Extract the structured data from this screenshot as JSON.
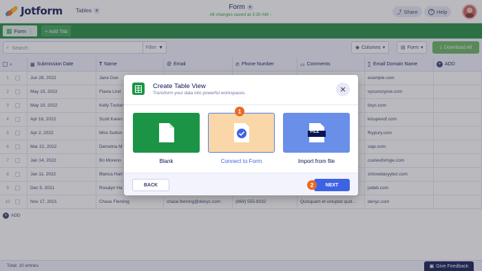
{
  "app": {
    "brand": "Jotform",
    "section": "Tables",
    "form_title": "Form",
    "save_status": "All changes saved at 3:30 AM",
    "share_label": "Share",
    "help_label": "Help"
  },
  "tabs": [
    {
      "label": "Form"
    },
    {
      "label": "+ Add Tab"
    }
  ],
  "toolbar": {
    "search_placeholder": "Search",
    "filter_label": "Filter",
    "columns_label": "Columns",
    "form_label": "Form",
    "download_label": "Download All"
  },
  "columns": [
    "Submission Date",
    "Name",
    "Email",
    "Phone Number",
    "Comments",
    "Email Domain Name",
    "ADD"
  ],
  "rows": [
    {
      "n": "1",
      "date": "Jun 28, 2022",
      "name": "Jane Doe",
      "email": "",
      "phone": "",
      "comments": "",
      "domain": "example.com"
    },
    {
      "n": "2",
      "date": "May 15, 2022",
      "name": "Flavia Lind",
      "email": "",
      "phone": "",
      "comments": "",
      "domain": "vycuxozyroe.com"
    },
    {
      "n": "3",
      "date": "May 10, 2022",
      "name": "Kelly Tucker",
      "email": "",
      "phone": "",
      "comments": "",
      "domain": "tixyc.com"
    },
    {
      "n": "4",
      "date": "Apr 16, 2022",
      "name": "Scott Karen",
      "email": "",
      "phone": "",
      "comments": "",
      "domain": "kinupesof.com"
    },
    {
      "n": "5",
      "date": "Apr 2, 2022",
      "name": "Mira Sutton",
      "email": "",
      "phone": "",
      "comments": "",
      "domain": "fhypury.com"
    },
    {
      "n": "6",
      "date": "Mar 22, 2022",
      "name": "Demetria M",
      "email": "",
      "phone": "",
      "comments": "",
      "domain": "siqe.com"
    },
    {
      "n": "7",
      "date": "Jan 14, 2022",
      "name": "Bo Moreno",
      "email": "",
      "phone": "",
      "comments": "",
      "domain": "cuxiwufomyje.com"
    },
    {
      "n": "8",
      "date": "Jan 11, 2022",
      "name": "Blanca Hart",
      "email": "",
      "phone": "",
      "comments": "",
      "domain": "ziniowdasyytez.com"
    },
    {
      "n": "9",
      "date": "Dec 5, 2021",
      "name": "Rosalyn Ha",
      "email": "",
      "phone": "",
      "comments": "",
      "domain": "jodeb.com"
    },
    {
      "n": "10",
      "date": "Nov 17, 2021",
      "name": "Chase Fleming",
      "email": "chase.fleming@denyc.com",
      "phone": "(869) 555-8332",
      "comments": "Quisquam et voluptat quid...",
      "domain": "denyc.com"
    }
  ],
  "add_row_label": "ADD",
  "footer": {
    "total": "Total: 10 entries",
    "feedback": "Give Feedback"
  },
  "modal": {
    "title": "Create Table View",
    "subtitle": "Transform your data into powerful workspaces.",
    "options": [
      {
        "label": "Blank"
      },
      {
        "label": "Connect to Form"
      },
      {
        "label": "Import from file",
        "icon_text": "FILE"
      }
    ],
    "step1": "1",
    "step2": "2",
    "back_label": "BACK",
    "next_label": "NEXT"
  },
  "colors": {
    "brand_green": "#1b9445",
    "tab_green": "#1f8a3d",
    "accent_blue": "#3d63e4",
    "step_orange": "#e86b25",
    "connect_bg": "#f9d7a9",
    "import_bg": "#6a8fe8"
  }
}
